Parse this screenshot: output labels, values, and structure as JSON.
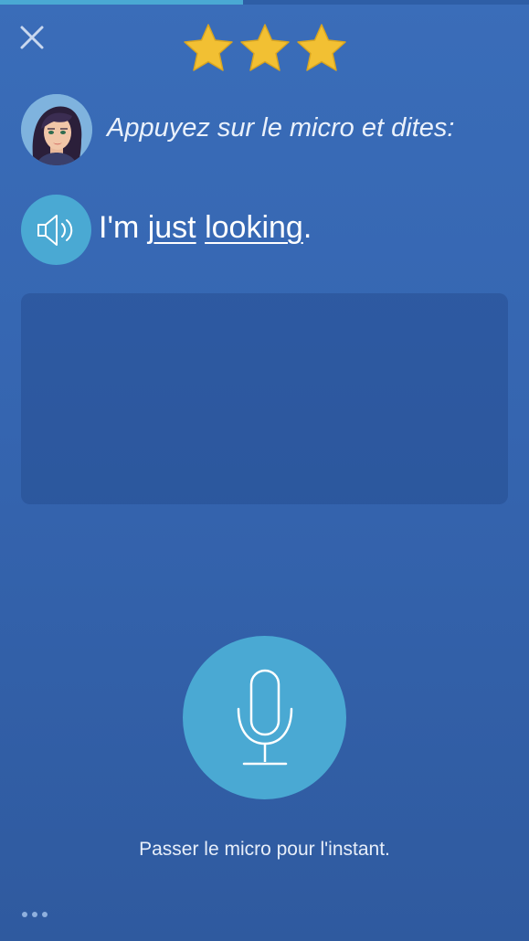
{
  "progress": {
    "fraction": 0.46
  },
  "header": {
    "close_icon": "close-icon",
    "stars": {
      "filled": 3,
      "total": 3,
      "color": "#f2c033"
    }
  },
  "instruction": {
    "avatar_icon": "woman-avatar",
    "prompt": "Appuyez sur le micro et dites:"
  },
  "phrase": {
    "speaker_icon": "speaker-icon",
    "words": [
      {
        "text": "I'm ",
        "underlined": false
      },
      {
        "text": "just",
        "underlined": true
      },
      {
        "text": " ",
        "underlined": false
      },
      {
        "text": "looking",
        "underlined": true
      },
      {
        "text": ".",
        "underlined": false
      }
    ]
  },
  "microphone": {
    "icon": "microphone-icon",
    "skip_label": "Passer le micro pour l'instant."
  },
  "footer": {
    "more_icon": "more-dots-icon"
  },
  "colors": {
    "accent": "#4aa9d3",
    "background": "#3565b0",
    "star": "#f2c033"
  }
}
